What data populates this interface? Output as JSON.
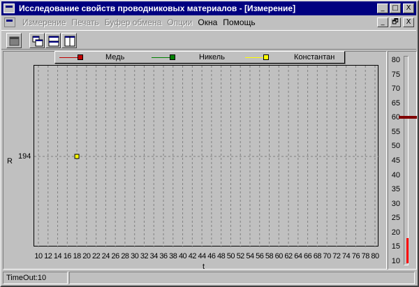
{
  "window": {
    "title": "Исследование свойств проводниковых материалов - [Измерение]",
    "caption_buttons": [
      "_",
      "□",
      "X"
    ],
    "mdi_buttons": [
      "_",
      "🗗",
      "X"
    ]
  },
  "menu": {
    "items": [
      {
        "label": "Измерение",
        "enabled": false
      },
      {
        "label": "Печать",
        "enabled": false
      },
      {
        "label": "Буфер обмена",
        "enabled": false
      },
      {
        "label": "Опции",
        "enabled": false
      },
      {
        "label": "Окна",
        "enabled": true
      },
      {
        "label": "Помощь",
        "enabled": true
      }
    ]
  },
  "toolbar": {
    "buttons": [
      "window-icon",
      "cascade-icon",
      "tile-horizontal-icon",
      "tile-vertical-icon"
    ]
  },
  "legend": {
    "items": [
      {
        "label": "Медь",
        "color": "#c00000"
      },
      {
        "label": "Никель",
        "color": "#008000"
      },
      {
        "label": "Константан",
        "color": "#ffff00"
      }
    ]
  },
  "chart_data": {
    "type": "scatter",
    "xlabel": "t",
    "ylabel": "R",
    "xlim": [
      10,
      80
    ],
    "ylim": [
      0,
      388
    ],
    "x_ticks": [
      10,
      12,
      14,
      16,
      18,
      20,
      22,
      24,
      26,
      28,
      30,
      32,
      34,
      36,
      38,
      40,
      42,
      44,
      46,
      48,
      50,
      52,
      54,
      56,
      58,
      60,
      62,
      64,
      66,
      68,
      70,
      72,
      74,
      76,
      78,
      80
    ],
    "y_ticks": [
      194
    ],
    "grid": true,
    "series": [
      {
        "name": "Константан",
        "color": "#ffff00",
        "points": [
          {
            "x": 18,
            "y": 194
          }
        ]
      }
    ]
  },
  "gauge": {
    "ticks": [
      80,
      75,
      70,
      65,
      60,
      55,
      50,
      45,
      40,
      35,
      30,
      25,
      20,
      15,
      10
    ],
    "min": 10,
    "max": 80,
    "current_value": 18,
    "setpoint": 60,
    "fill_color": "#ff0000",
    "marker_color": "#800000"
  },
  "status": {
    "text": "TimeOut:10"
  }
}
